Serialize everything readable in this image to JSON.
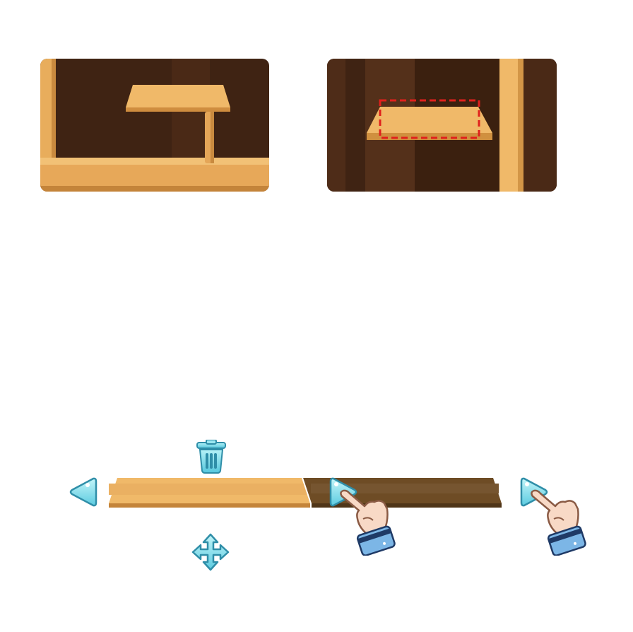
{
  "scene": {
    "example_panels": [
      {
        "name": "shelf-with-support-example"
      },
      {
        "name": "floating-shelf-selected-example"
      }
    ],
    "editor": {
      "controls": [
        "trash-icon",
        "arrow-left-icon",
        "arrow-right-icon",
        "move-icon"
      ],
      "hints": [
        "pointing-hand-icon",
        "pointing-hand-icon"
      ]
    }
  },
  "colors": {
    "wall_dark": "#3f2313",
    "wall_mid": "#4e2c18",
    "wood_light": "#f0b969",
    "wood_mid": "#dd9c4c",
    "wood_edge": "#b9772f",
    "wood_dark": "#6b4a24",
    "wood_dark_top": "#7b5a30",
    "selection_dash": "#e0201c",
    "control_cyan": "#8fe3ee",
    "control_outline": "#2f8ea8"
  }
}
